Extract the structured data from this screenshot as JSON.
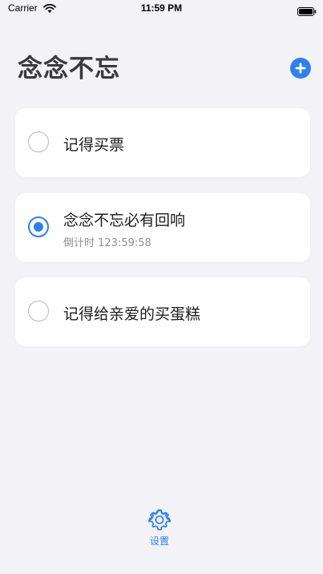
{
  "status_bar": {
    "carrier": "Carrier",
    "time": "11:59 PM",
    "icons": [
      "wifi-icon",
      "battery-icon"
    ]
  },
  "header": {
    "title": "念念不忘",
    "add_icon": "plus-circle-icon"
  },
  "todos": [
    {
      "title": "记得买票",
      "checked": false
    },
    {
      "title": "念念不忘必有回响",
      "checked": true,
      "countdown": "倒计时 123:59:58"
    },
    {
      "title": "记得给亲爱的买蛋糕",
      "checked": false
    }
  ],
  "tab_bar": {
    "settings_label": "设置",
    "settings_icon": "gear-icon"
  },
  "colors": {
    "accent": "#2f80ed",
    "background": "#f2f2f7",
    "card": "#ffffff",
    "secondary_text": "#8e8e93"
  }
}
